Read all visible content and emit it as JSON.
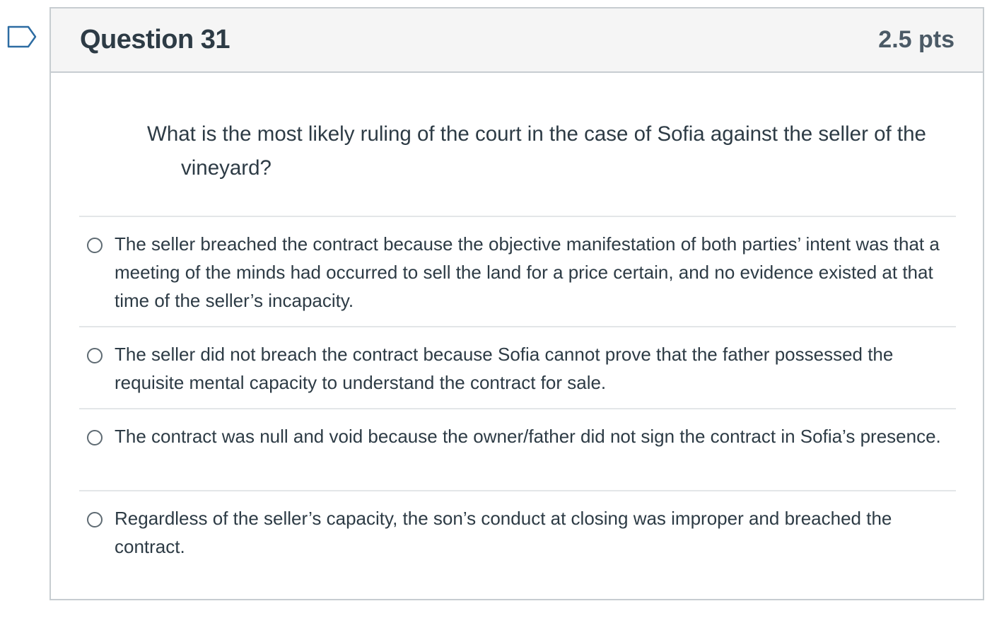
{
  "question": {
    "title": "Question 31",
    "points": "2.5 pts",
    "text": "What is the most likely ruling of the court in the case of Sofia against the seller of the vineyard?"
  },
  "answers": [
    {
      "label": "The seller breached the contract because the objective manifestation of both parties’ intent was that a meeting of the minds had occurred to sell the land for a price certain, and no evidence existed at that time of the seller’s incapacity.",
      "selected": false
    },
    {
      "label": "The seller did not breach the contract because Sofia cannot prove that the father possessed the requisite mental capacity to understand the contract for sale.",
      "selected": false
    },
    {
      "label": "The contract was null and void because the owner/father did not sign the contract in Sofia’s presence.",
      "selected": false
    },
    {
      "label": "Regardless of the seller’s capacity, the son’s conduct at closing was improper and breached the contract.",
      "selected": false
    }
  ],
  "icons": {
    "flag": "flag-question-icon",
    "radio": "radio-button-icon"
  },
  "colors": {
    "text": "#2d3b45",
    "border": "#c7cdd1",
    "header_bg": "#f5f5f5",
    "flag_stroke": "#2d6ca2"
  }
}
